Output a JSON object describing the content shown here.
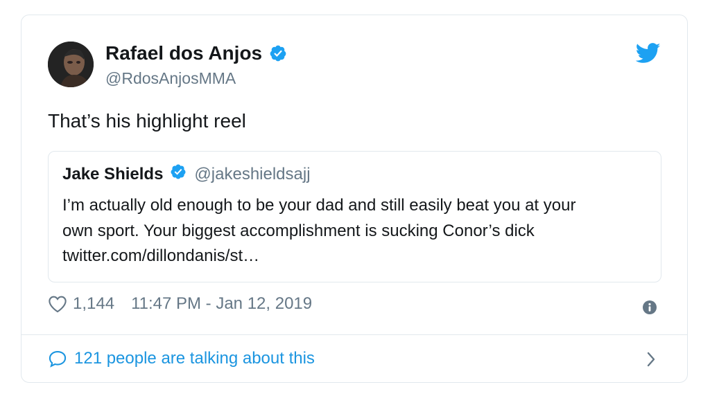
{
  "tweet": {
    "author": {
      "display_name": "Rafael dos Anjos",
      "handle": "@RdosAnjosMMA",
      "verified": true,
      "avatar_icon": "profile-photo"
    },
    "text": "That’s his highlight reel",
    "quoted_tweet": {
      "display_name": "Jake Shields",
      "handle": "@jakeshieldsajj",
      "verified": true,
      "lines": [
        "I’m actually old enough to be your dad and still easily beat you at your",
        "own sport.  Your biggest accomplishment is sucking Conor’s dick",
        "twitter.com/dillondanis/st…"
      ]
    },
    "likes": "1,144",
    "timestamp": "11:47 PM - Jan 12, 2019",
    "conversation": "121 people are talking about this",
    "icons": {
      "brand": "twitter-bird-icon",
      "like": "heart-icon",
      "info": "info-icon",
      "reply": "speech-bubble-icon",
      "chevron": "chevron-right-icon"
    },
    "colors": {
      "brand_blue": "#1da1f2",
      "link_blue": "#1b95e0",
      "secondary_text": "#657786",
      "border": "#e1e8ed"
    }
  }
}
